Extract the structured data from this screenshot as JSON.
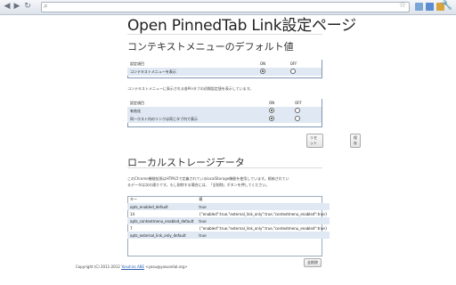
{
  "browser": {
    "address_value": "",
    "colors": {
      "ext1": "#7aa6d6",
      "ext2": "#5b8bd0",
      "ext3": "#d8a33a"
    }
  },
  "page": {
    "title": "Open PinnedTab Link設定ページ",
    "section1": {
      "heading": "コンテキストメニューのデフォルト値",
      "table1": {
        "headers": [
          "設定項目",
          "ON",
          "OFF"
        ],
        "rows": [
          {
            "label": "コンテキストメニューを表示",
            "on": true
          }
        ]
      },
      "description": "コンテキストメニューに表示される各Pinタブの初期設定値を表示しています。",
      "table2": {
        "headers": [
          "設定項目",
          "ON",
          "OFF"
        ],
        "rows": [
          {
            "label": "有効化",
            "on": true
          },
          {
            "label": "同一ホスト内のリンクは同じタブ内で表示",
            "on": true
          }
        ]
      },
      "reset_label": "リセット",
      "save_label": "保存"
    },
    "section2": {
      "heading": "ローカルストレージデータ",
      "description_line1": "このChrome機能拡張はHTML5で定義されているlocalStorage機能を使用しています。格納されてい",
      "description_line2": "るデータは次の通りです。もし削除する場合には、「全削除」ボタンを押してください。",
      "table": {
        "headers": [
          "キー",
          "値"
        ],
        "rows": [
          {
            "key": "opts_enabled_default",
            "value": "true"
          },
          {
            "key": "14",
            "value": "{\"enabled\":true,\"external_link_only\":true,\"contextmenu_enabled\":true}"
          },
          {
            "key": "opts_contextmenu_enabled_default",
            "value": "true"
          },
          {
            "key": "7",
            "value": "{\"enabled\":true,\"external_link_only\":true,\"contextmenu_enabled\":true}"
          },
          {
            "key": "opts_external_link_only_default",
            "value": "true"
          }
        ]
      },
      "delete_all_label": "全削除"
    },
    "footer": {
      "prefix": "Copyright (C) 2011-2012",
      "author": "Yasuhiro ABE",
      "email": "<yasu@yasundial.org>"
    }
  }
}
